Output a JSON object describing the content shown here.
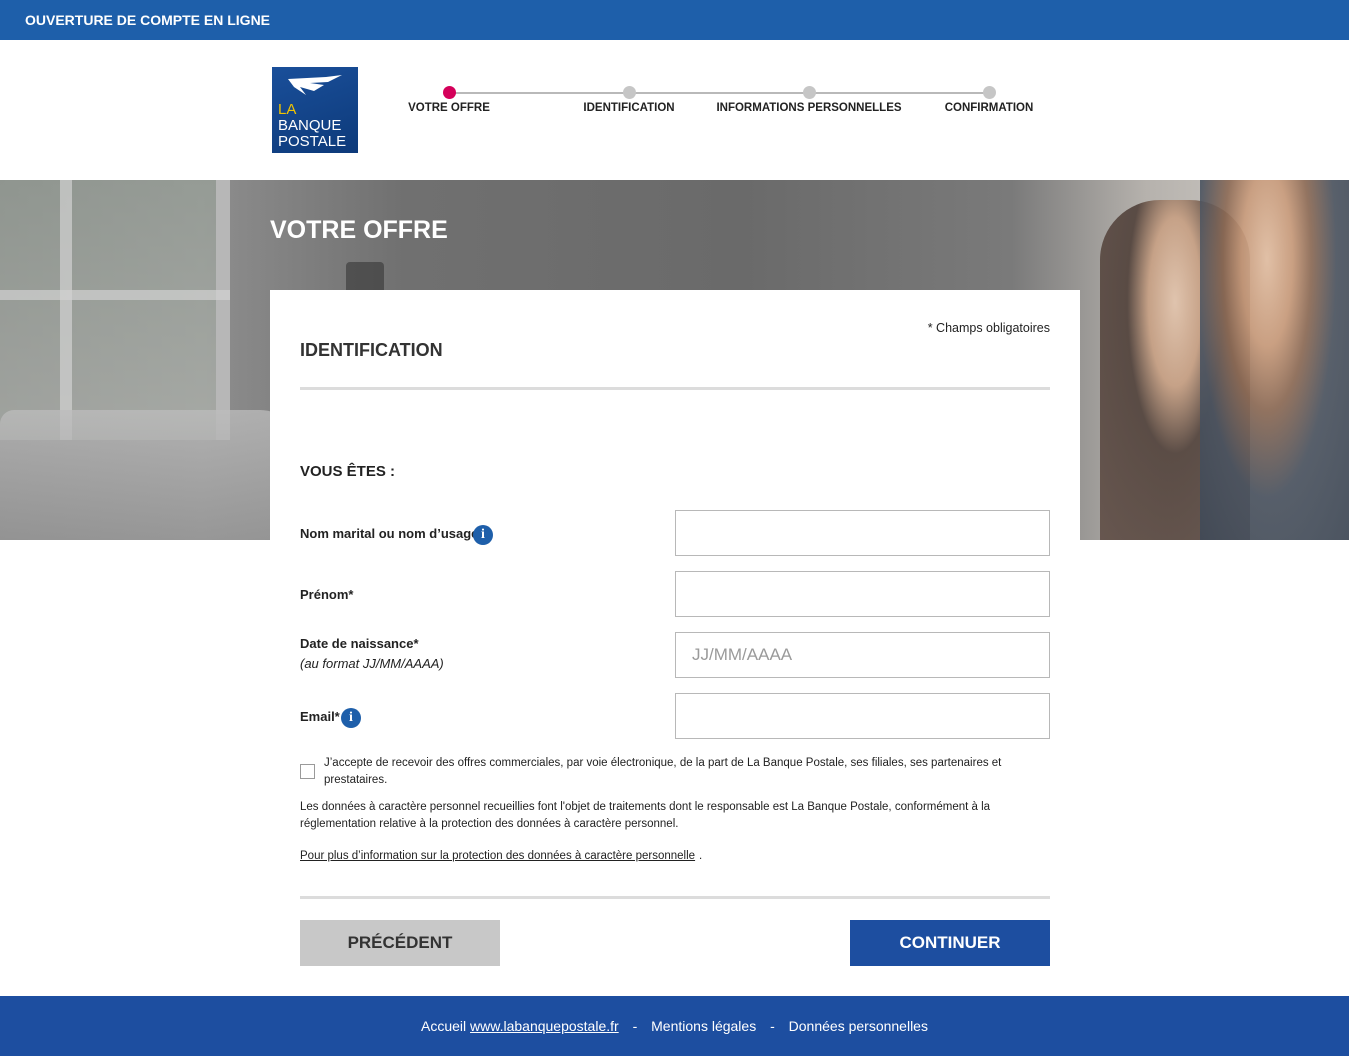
{
  "topbar": {
    "title": "OUVERTURE DE COMPTE EN LIGNE"
  },
  "logo": {
    "line1": "LA",
    "line2": "BANQUE",
    "line3": "POSTALE"
  },
  "stepper": {
    "steps": [
      {
        "label": "VOTRE OFFRE",
        "active": true
      },
      {
        "label": "IDENTIFICATION",
        "active": false
      },
      {
        "label": "INFORMATIONS PERSONNELLES",
        "active": false
      },
      {
        "label": "CONFIRMATION",
        "active": false
      }
    ],
    "active_color": "#d4005a",
    "inactive_color": "#c6c6c6"
  },
  "hero": {
    "title": "VOTRE OFFRE"
  },
  "form": {
    "required_note": "* Champs obligatoires",
    "section_title": "IDENTIFICATION",
    "subtitle": "VOUS ÊTES :",
    "fields": {
      "nom": {
        "label": "Nom marital ou nom d’usage*",
        "value": "",
        "placeholder": "",
        "info_icon": "info-icon"
      },
      "prenom": {
        "label": "Prénom*",
        "value": "",
        "placeholder": ""
      },
      "date": {
        "label": "Date de naissance*",
        "hint": "(au format JJ/MM/AAAA)",
        "value": "",
        "placeholder": "JJ/MM/AAAA"
      },
      "email": {
        "label": "Email*",
        "value": "",
        "placeholder": "",
        "info_icon": "info-icon"
      }
    },
    "consent_text": "J’accepte de recevoir des offres commerciales, par voie électronique, de la part de La Banque Postale, ses filiales, ses partenaires et prestataires.",
    "consent_checked": false,
    "legal_text": "Les données à caractère personnel recueillies font l'objet de traitements dont le responsable est La Banque Postale, conformément à la réglementation relative à la protection des données à caractère personnel.",
    "more_link": "Pour plus d’information sur la protection des données à caractère personnelle",
    "more_link_end": ".",
    "prev_label": "PRÉCÉDENT",
    "next_label": "CONTINUER"
  },
  "footer": {
    "home_prefix": "Accueil",
    "home_link": "www.labanquepostale.fr",
    "separator": "-",
    "legal": "Mentions légales",
    "privacy": "Données personnelles"
  },
  "colors": {
    "brand_blue": "#1e5faa",
    "button_blue": "#1d4ea0",
    "button_grey": "#c8c8c8",
    "logo_yellow": "#f2c400"
  }
}
